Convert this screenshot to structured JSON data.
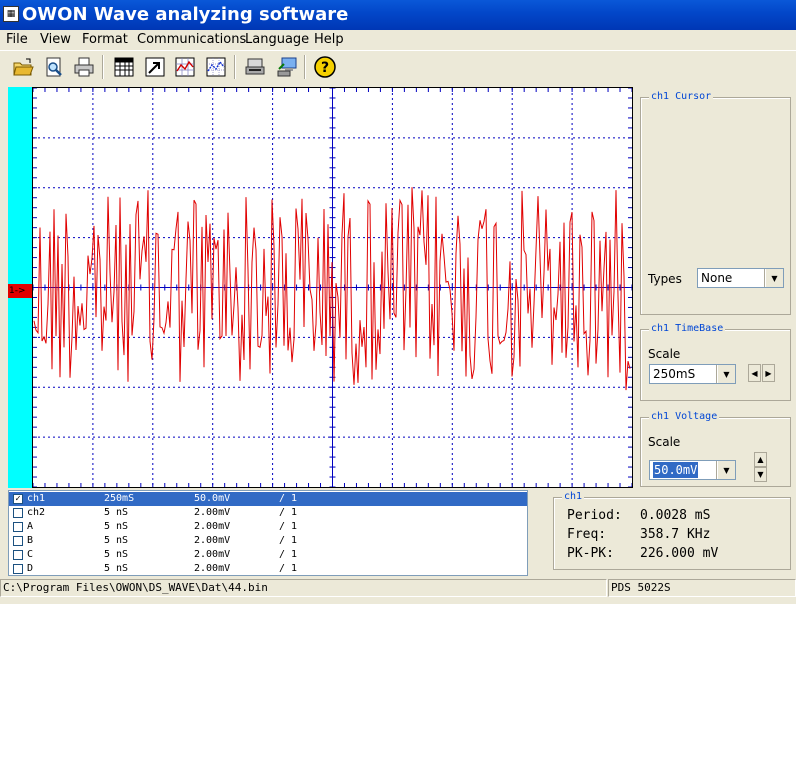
{
  "window": {
    "title": "OWON Wave analyzing software"
  },
  "menu": [
    "File",
    "View",
    "Format",
    "Communications",
    "Language",
    "Help"
  ],
  "toolbar": {
    "group1": [
      "open-folder-icon",
      "print-preview-icon",
      "print-icon"
    ],
    "group2": [
      "table-icon",
      "export-icon",
      "waveform-view-icon",
      "dotted-view-icon"
    ],
    "group3": [
      "connect-usb-icon",
      "network-computer-icon"
    ],
    "group4": [
      "help-icon"
    ]
  },
  "scope": {
    "channel_marker": "1->",
    "trace_color": "#e00000",
    "grid_color": "#0000c0"
  },
  "cursor_panel": {
    "label": "ch1 Cursor",
    "types_label": "Types",
    "types_value": "None"
  },
  "timebase_panel": {
    "label": "ch1 TimeBase",
    "scale_label": "Scale",
    "scale_value": "250mS"
  },
  "voltage_panel": {
    "label": "ch1 Voltage",
    "scale_label": "Scale",
    "scale_value": "50.0mV"
  },
  "channels": [
    {
      "name": "ch1",
      "time": "250mS",
      "volt": "50.0mV",
      "probe": "/ 1",
      "checked": true,
      "selected": true
    },
    {
      "name": "ch2",
      "time": "5  nS",
      "volt": "2.00mV",
      "probe": "/ 1",
      "checked": false,
      "selected": false
    },
    {
      "name": "A",
      "time": "5  nS",
      "volt": "2.00mV",
      "probe": "/ 1",
      "checked": false,
      "selected": false
    },
    {
      "name": "B",
      "time": "5  nS",
      "volt": "2.00mV",
      "probe": "/ 1",
      "checked": false,
      "selected": false
    },
    {
      "name": "C",
      "time": "5  nS",
      "volt": "2.00mV",
      "probe": "/ 1",
      "checked": false,
      "selected": false
    },
    {
      "name": "D",
      "time": "5  nS",
      "volt": "2.00mV",
      "probe": "/ 1",
      "checked": false,
      "selected": false
    }
  ],
  "measure": {
    "label": "ch1",
    "period_label": "Period:",
    "period_value": "0.0028 mS",
    "freq_label": "Freq:",
    "freq_value": "358.7 KHz",
    "pkpk_label": "PK-PK:",
    "pkpk_value": "226.000 mV"
  },
  "status": {
    "path": "C:\\Program Files\\OWON\\DS_WAVE\\Dat\\44.bin",
    "model": "PDS 5022S"
  }
}
